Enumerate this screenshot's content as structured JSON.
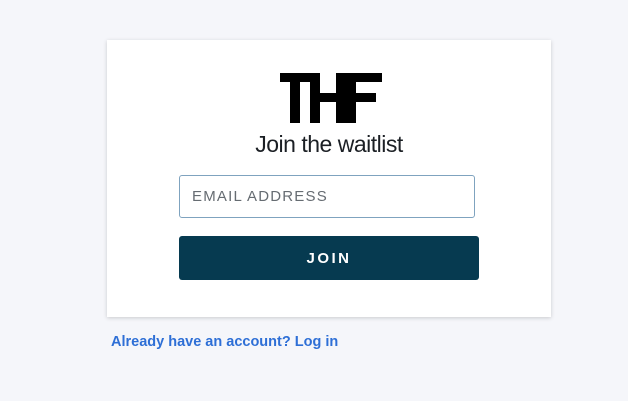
{
  "brand": {
    "logo_text": "THF",
    "logo_color": "#000000"
  },
  "waitlist": {
    "title": "Join the waitlist",
    "email_placeholder": "EMAIL ADDRESS",
    "email_value": "",
    "join_label": "JOIN",
    "join_color": "#063a50"
  },
  "footer": {
    "login_link": "Already have an account? Log in",
    "link_color": "#2e6fd6"
  }
}
